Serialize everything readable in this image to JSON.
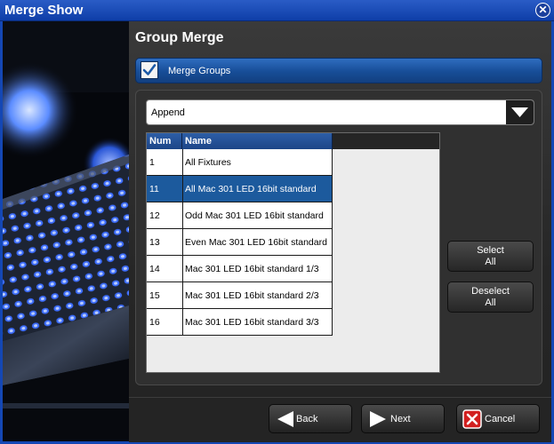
{
  "window": {
    "title": "Merge Show"
  },
  "page": {
    "heading": "Group Merge"
  },
  "merge": {
    "label": "Merge Groups",
    "checked": true
  },
  "mode": {
    "selected": "Append"
  },
  "table": {
    "columns": [
      "Num",
      "Name"
    ],
    "rows": [
      {
        "num": "1",
        "name": "All Fixtures",
        "selected": false
      },
      {
        "num": "11",
        "name": "All Mac 301 LED 16bit standard",
        "selected": true
      },
      {
        "num": "12",
        "name": "Odd Mac 301 LED 16bit standard",
        "selected": false
      },
      {
        "num": "13",
        "name": "Even Mac 301 LED 16bit standard",
        "selected": false
      },
      {
        "num": "14",
        "name": "Mac 301 LED 16bit standard 1/3",
        "selected": false
      },
      {
        "num": "15",
        "name": "Mac 301 LED 16bit standard 2/3",
        "selected": false
      },
      {
        "num": "16",
        "name": "Mac 301 LED 16bit standard 3/3",
        "selected": false
      }
    ]
  },
  "actions": {
    "select_all": [
      "Select",
      "All"
    ],
    "deselect_all": [
      "Deselect",
      "All"
    ]
  },
  "nav": {
    "back": "Back",
    "next": "Next",
    "cancel": "Cancel"
  },
  "icons": {
    "close": "close-circle-icon",
    "check": "checkmark-icon",
    "dropdown": "triangle-down-icon",
    "back": "arrow-left-icon",
    "next": "arrow-right-icon",
    "cancel": "red-x-icon"
  },
  "colors": {
    "titlebar": "#1447b4",
    "accent": "#1c5a9d",
    "cancel": "#d21f1f"
  }
}
